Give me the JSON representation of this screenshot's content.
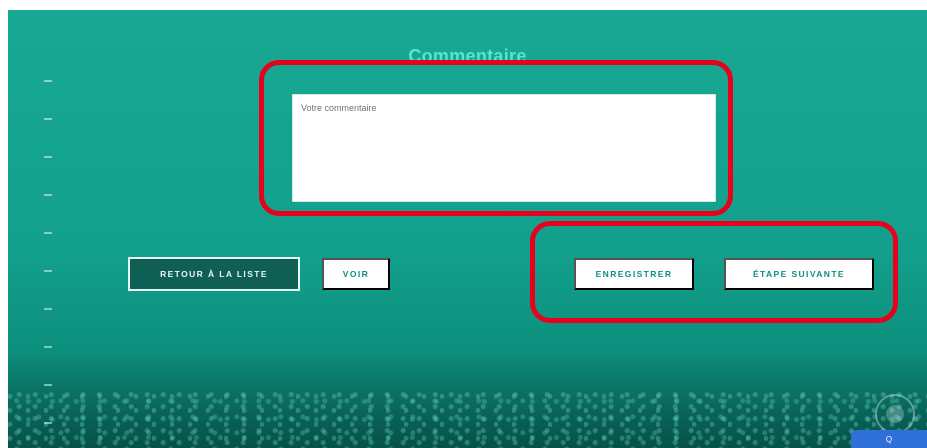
{
  "form": {
    "title": "Commentaire",
    "comment_placeholder": "Votre commentaire"
  },
  "buttons": {
    "back": "Retour à la liste",
    "view": "Voir",
    "save": "Enregistrer",
    "next": "Étape suivante"
  },
  "widget": {
    "badge_text": "Q"
  },
  "colors": {
    "background": "#12a08c",
    "title": "#56e6cf",
    "annotation": "#e8001c",
    "button_text": "#0d8f7d",
    "back_button_bg": "#0f5f55"
  },
  "icons": [
    "chat-icon"
  ]
}
